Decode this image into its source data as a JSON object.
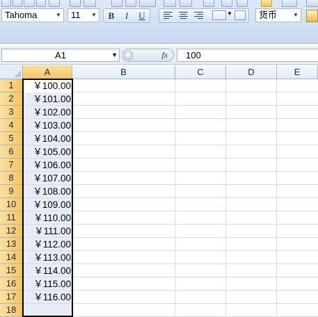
{
  "ribbon": {
    "font_name": "Tahoma",
    "font_size": "11",
    "bold_label": "B",
    "italic_label": "I",
    "underline_label": "U",
    "number_format": "货币"
  },
  "formula_bar": {
    "name_box": "A1",
    "fx_label": "fx",
    "content": "100"
  },
  "sheet": {
    "columns": [
      "A",
      "B",
      "C",
      "D",
      "E"
    ],
    "selected_column": "A",
    "rows": [
      "1",
      "2",
      "3",
      "4",
      "5",
      "6",
      "7",
      "8",
      "9",
      "10",
      "11",
      "12",
      "13",
      "14",
      "15",
      "16",
      "17",
      "18"
    ],
    "column_a_values": [
      "￥100.00",
      "￥101.00",
      "￥102.00",
      "￥103.00",
      "￥104.00",
      "￥105.00",
      "￥106.00",
      "￥107.00",
      "￥108.00",
      "￥109.00",
      "￥110.00",
      "￥111.00",
      "￥112.00",
      "￥113.00",
      "￥114.00",
      "￥115.00",
      "￥116.00"
    ]
  },
  "colors": {
    "selection_header": "#f6c45e",
    "ribbon_bg": "#d2e1f4",
    "gridline": "#d4dbe5"
  }
}
